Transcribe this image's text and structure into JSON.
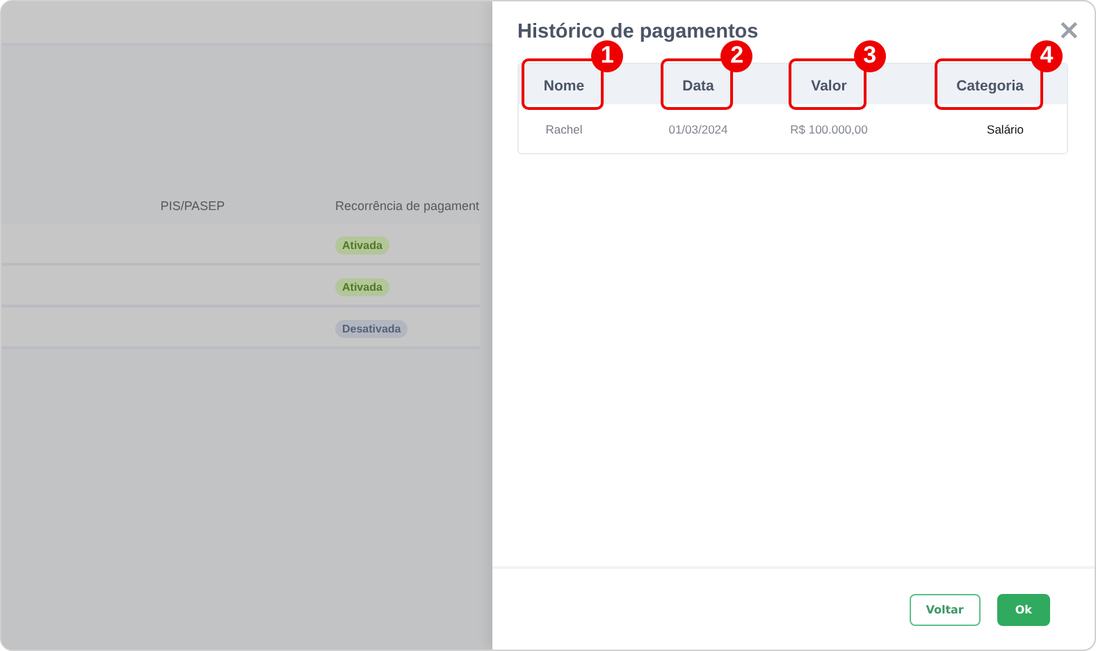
{
  "background_table": {
    "columns": [
      "PIS/PASEP",
      "Recorrência de pagament"
    ],
    "rows": [
      {
        "status": "Ativada",
        "kind": "active"
      },
      {
        "status": "Ativada",
        "kind": "active"
      },
      {
        "status": "Desativada",
        "kind": "inactive"
      }
    ]
  },
  "drawer": {
    "title": "Histórico de pagamentos",
    "close": "×",
    "table": {
      "columns": [
        {
          "label": "Nome",
          "callout": "1"
        },
        {
          "label": "Data",
          "callout": "2"
        },
        {
          "label": "Valor",
          "callout": "3"
        },
        {
          "label": "Categoria",
          "callout": "4"
        }
      ],
      "rows": [
        {
          "cells": [
            "Rachel",
            "01/03/2024",
            "R$ 100.000,00",
            "Salário"
          ]
        }
      ]
    },
    "buttons": [
      {
        "label": "Voltar",
        "kind": "secondary"
      },
      {
        "label": "Ok",
        "kind": "primary"
      }
    ]
  }
}
